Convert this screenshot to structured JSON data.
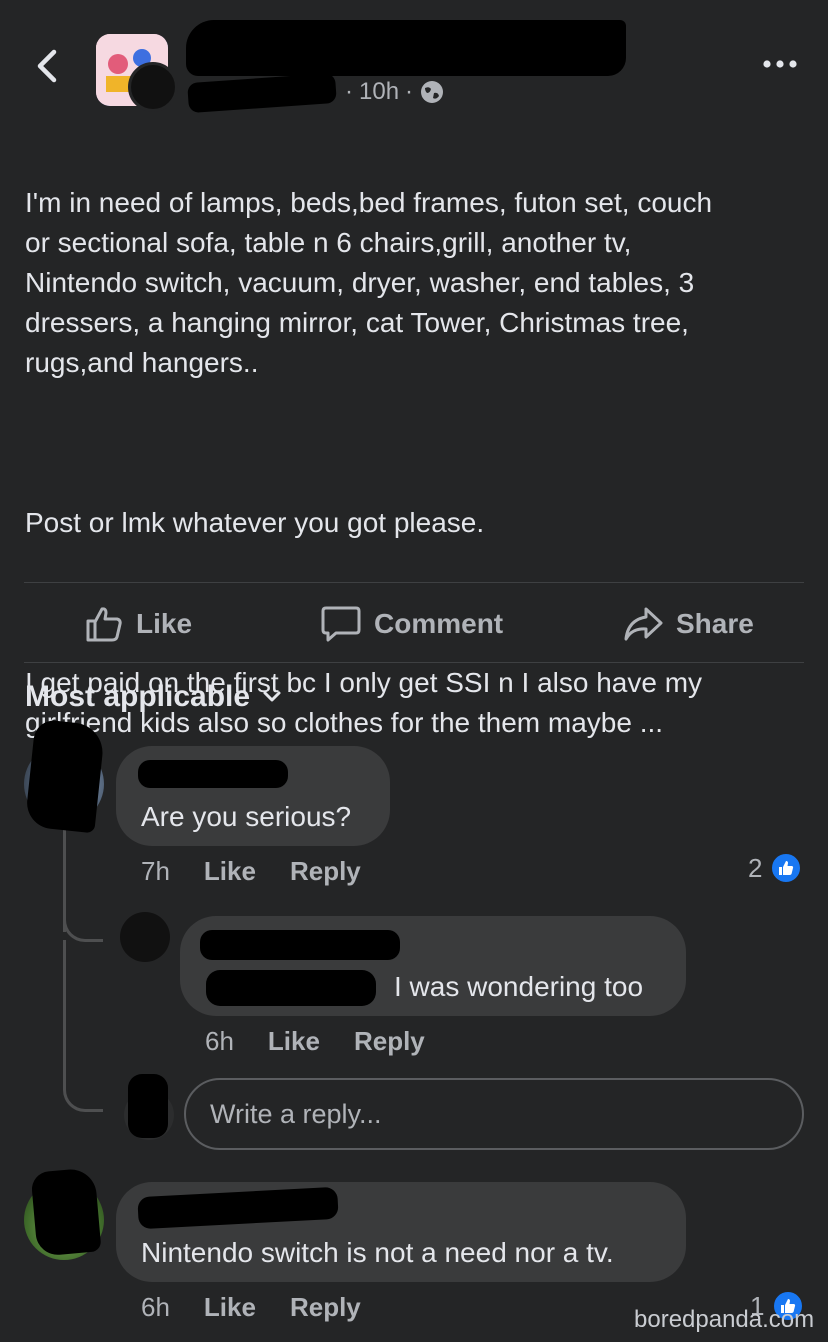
{
  "header": {
    "time": "10h",
    "separator": "·",
    "privacy_icon": "globe-icon",
    "back_icon": "chevron-left-icon",
    "more_icon": "more-dots-icon"
  },
  "post": {
    "paragraph1": "I'm in need of lamps, beds,bed frames, futon set, couch\nor sectional sofa, table n 6 chairs,grill, another tv,\nNintendo switch, vacuum, dryer, washer, end tables, 3\ndressers, a hanging mirror, cat Tower, Christmas tree,\nrugs,and hangers..",
    "paragraph2": "Post or lmk whatever you got please.",
    "paragraph3": "I get paid on the first bc I only get SSI n I also have my\ngirlfriend kids also so clothes for the them maybe ..."
  },
  "actions": {
    "like": "Like",
    "comment": "Comment",
    "share": "Share"
  },
  "sort": {
    "label": "Most applicable"
  },
  "comments": [
    {
      "text": "Are you serious?",
      "time": "7h",
      "like": "Like",
      "reply": "Reply",
      "reaction_count": "2"
    },
    {
      "text": "I was wondering  too",
      "time": "6h",
      "like": "Like",
      "reply": "Reply"
    },
    {
      "text": "Nintendo switch is not a need nor a tv.",
      "time": "6h",
      "like": "Like",
      "reply": "Reply",
      "reaction_count": "1"
    }
  ],
  "reply_input": {
    "placeholder": "Write a reply..."
  },
  "watermark": "boredpanda.com",
  "colors": {
    "background": "#242526",
    "bubble": "#3a3b3c",
    "text": "#e4e6eb",
    "secondary": "#b0b3b8",
    "like_blue": "#1877f2"
  }
}
